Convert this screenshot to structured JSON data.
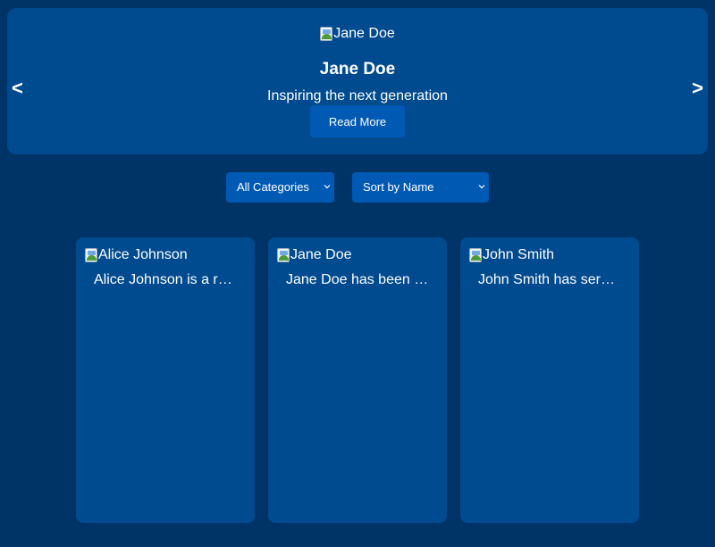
{
  "hero": {
    "prev_label": "<",
    "next_label": ">",
    "image_alt": "Jane Doe",
    "name": "Jane Doe",
    "tagline": "Inspiring the next generation",
    "button_label": "Read More"
  },
  "filters": {
    "category_selected": "All Categories",
    "sort_selected": "Sort by Name"
  },
  "cards": [
    {
      "image_alt": "Alice Johnson",
      "text": "Alice Johnson is a r…"
    },
    {
      "image_alt": "Jane Doe",
      "text": "Jane Doe has been …"
    },
    {
      "image_alt": "John Smith",
      "text": "John Smith has ser…"
    }
  ],
  "colors": {
    "page_bg": "#003366",
    "panel_bg": "#004a8f",
    "control_bg": "#0059b3",
    "text": "#ffffff"
  },
  "icons": {
    "broken_image": "broken-image-icon",
    "dropdown": "chevron-down-icon"
  }
}
